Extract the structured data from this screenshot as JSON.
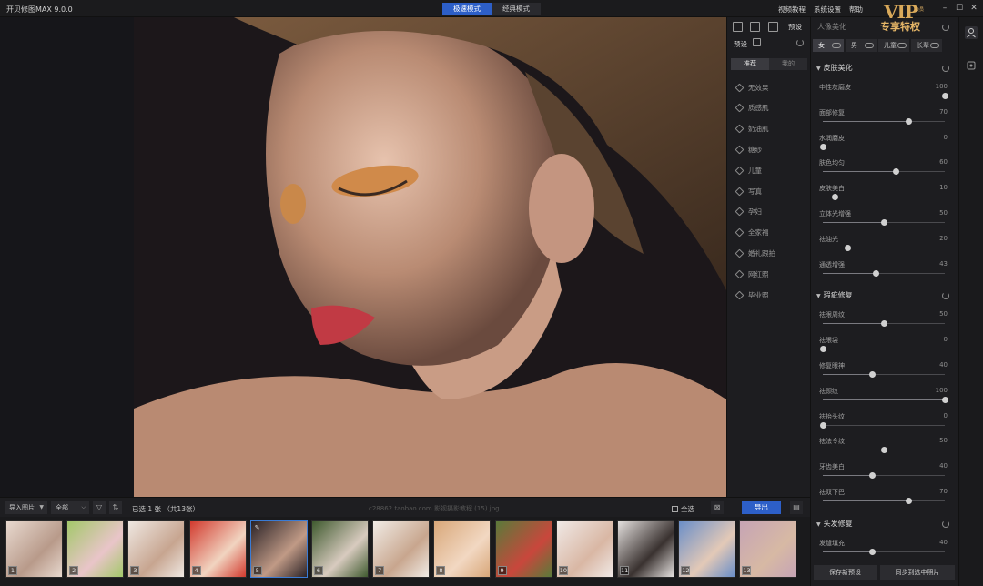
{
  "app": {
    "title": "开贝修图MAX 9.0.0",
    "modes": [
      {
        "label": "极速模式",
        "active": true
      },
      {
        "label": "经典模式",
        "active": false
      }
    ],
    "top_links": [
      "视频教程",
      "系统设置",
      "帮助"
    ]
  },
  "preset_panel": {
    "header": "预设",
    "toolbar_label": "预设",
    "tabs": [
      {
        "label": "推荐",
        "active": true
      },
      {
        "label": "我的",
        "active": false
      }
    ],
    "items": [
      "无效果",
      "质感肌",
      "奶油肌",
      "糖纱",
      "儿童",
      "写真",
      "孕妇",
      "全家福",
      "婚礼跟拍",
      "网红照",
      "毕业照"
    ]
  },
  "right_panel": {
    "title": "人像美化",
    "vip": {
      "big": "VIP",
      "small": "会员",
      "sub": "专享特权"
    },
    "genders": [
      {
        "label": "女",
        "active": true
      },
      {
        "label": "男",
        "active": false
      },
      {
        "label": "儿童",
        "active": false
      },
      {
        "label": "长辈",
        "active": false
      }
    ],
    "sections": [
      {
        "title": "皮肤美化",
        "sliders": [
          {
            "label": "中性灰磨皮",
            "value": 100
          },
          {
            "label": "面部修复",
            "value": 70
          },
          {
            "label": "水润磨皮",
            "value": 0
          },
          {
            "label": "肤色均匀",
            "value": 60
          },
          {
            "label": "皮肤美白",
            "value": 10
          },
          {
            "label": "立体光增强",
            "value": 50
          },
          {
            "label": "祛油光",
            "value": 20
          },
          {
            "label": "通透增强",
            "value": 43
          }
        ]
      },
      {
        "title": "瑕疵修复",
        "sliders": [
          {
            "label": "祛眼周纹",
            "value": 50
          },
          {
            "label": "祛眼袋",
            "value": 0
          },
          {
            "label": "修复眼神",
            "value": 40
          },
          {
            "label": "祛颈纹",
            "value": 100
          },
          {
            "label": "祛抬头纹",
            "value": 0
          },
          {
            "label": "祛法令纹",
            "value": 50
          },
          {
            "label": "牙齿美白",
            "value": 40
          },
          {
            "label": "祛双下巴",
            "value": 70
          }
        ]
      },
      {
        "title": "头发修复",
        "sliders": [
          {
            "label": "发缝填充",
            "value": 40
          }
        ]
      }
    ],
    "footer": {
      "save_preset": "保存新预设",
      "sync": "同步到选中照片"
    }
  },
  "bottom_bar": {
    "import_label": "导入图片",
    "filter_label": "全部",
    "selection": "已选 1 张 （共13张）",
    "filename": "c28862.taobao.com 影视摄影教程 (15).jpg",
    "select_all": "全选",
    "export": "导出"
  },
  "thumbnails": [
    {
      "num": "1",
      "c1": "#e8d9cf",
      "c2": "#b89a8a"
    },
    {
      "num": "2",
      "c1": "#a3c86a",
      "c2": "#e9c5c9"
    },
    {
      "num": "3",
      "c1": "#efe8e2",
      "c2": "#c7a590"
    },
    {
      "num": "4",
      "c1": "#d23a2e",
      "c2": "#f1d4c0"
    },
    {
      "num": "5",
      "c1": "#2a2226",
      "c2": "#c09a86",
      "selected": true
    },
    {
      "num": "6",
      "c1": "#3f5a2f",
      "c2": "#d8cbbf"
    },
    {
      "num": "7",
      "c1": "#f1ece6",
      "c2": "#c8a68e"
    },
    {
      "num": "8",
      "c1": "#d8a779",
      "c2": "#f2d8c2"
    },
    {
      "num": "9",
      "c1": "#5a7a3a",
      "c2": "#c9473c"
    },
    {
      "num": "10",
      "c1": "#f0e9e6",
      "c2": "#d9b7a4"
    },
    {
      "num": "11",
      "c1": "#e4e0de",
      "c2": "#3a3230"
    },
    {
      "num": "12",
      "c1": "#6a8ec8",
      "c2": "#e3c9b7"
    },
    {
      "num": "13",
      "c1": "#c6a4b5",
      "c2": "#d7b9a4"
    }
  ],
  "colors": {
    "accent": "#2d5fc8",
    "selected_border": "#3a7bd5"
  }
}
